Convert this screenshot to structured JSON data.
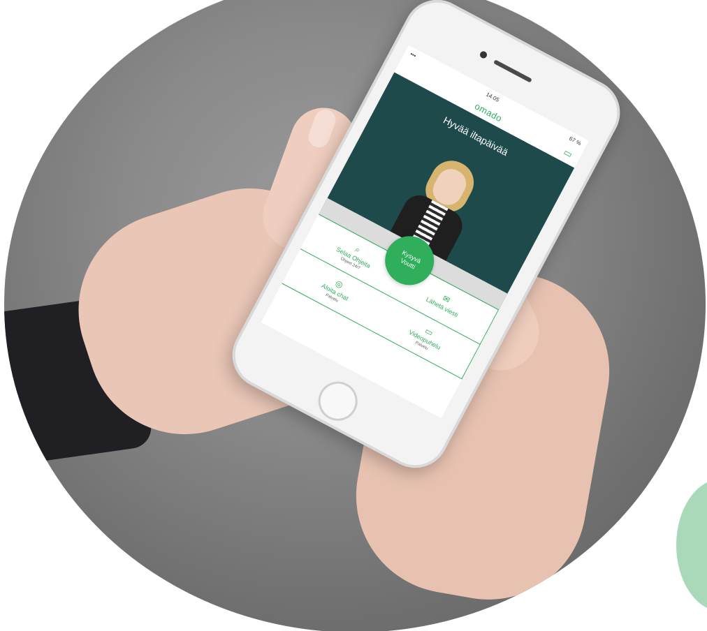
{
  "colors": {
    "brand": "#2fae5c",
    "hero_background": "#1e4a4c",
    "accent_circle": "#a9d9b9",
    "background": "#ffffff"
  },
  "phone": {
    "status": {
      "signal": "••• ",
      "time": "14.05",
      "battery": "67 %"
    },
    "brand": "omado",
    "greeting": "Hyvää iltapäivää",
    "cta_label": "Kysyvä Voutti",
    "menu": [
      {
        "icon": "search-icon",
        "label": "Selaa Ohjeita",
        "sub": "Ohjeet 24/7"
      },
      {
        "icon": "mail-icon",
        "label": "Lähetä viesti",
        "sub": ""
      },
      {
        "icon": "chat-icon",
        "label": "Aloita chat",
        "sub": "Palvelu"
      },
      {
        "icon": "video-icon",
        "label": "Videopuhelu",
        "sub": "Palvelu"
      }
    ]
  }
}
